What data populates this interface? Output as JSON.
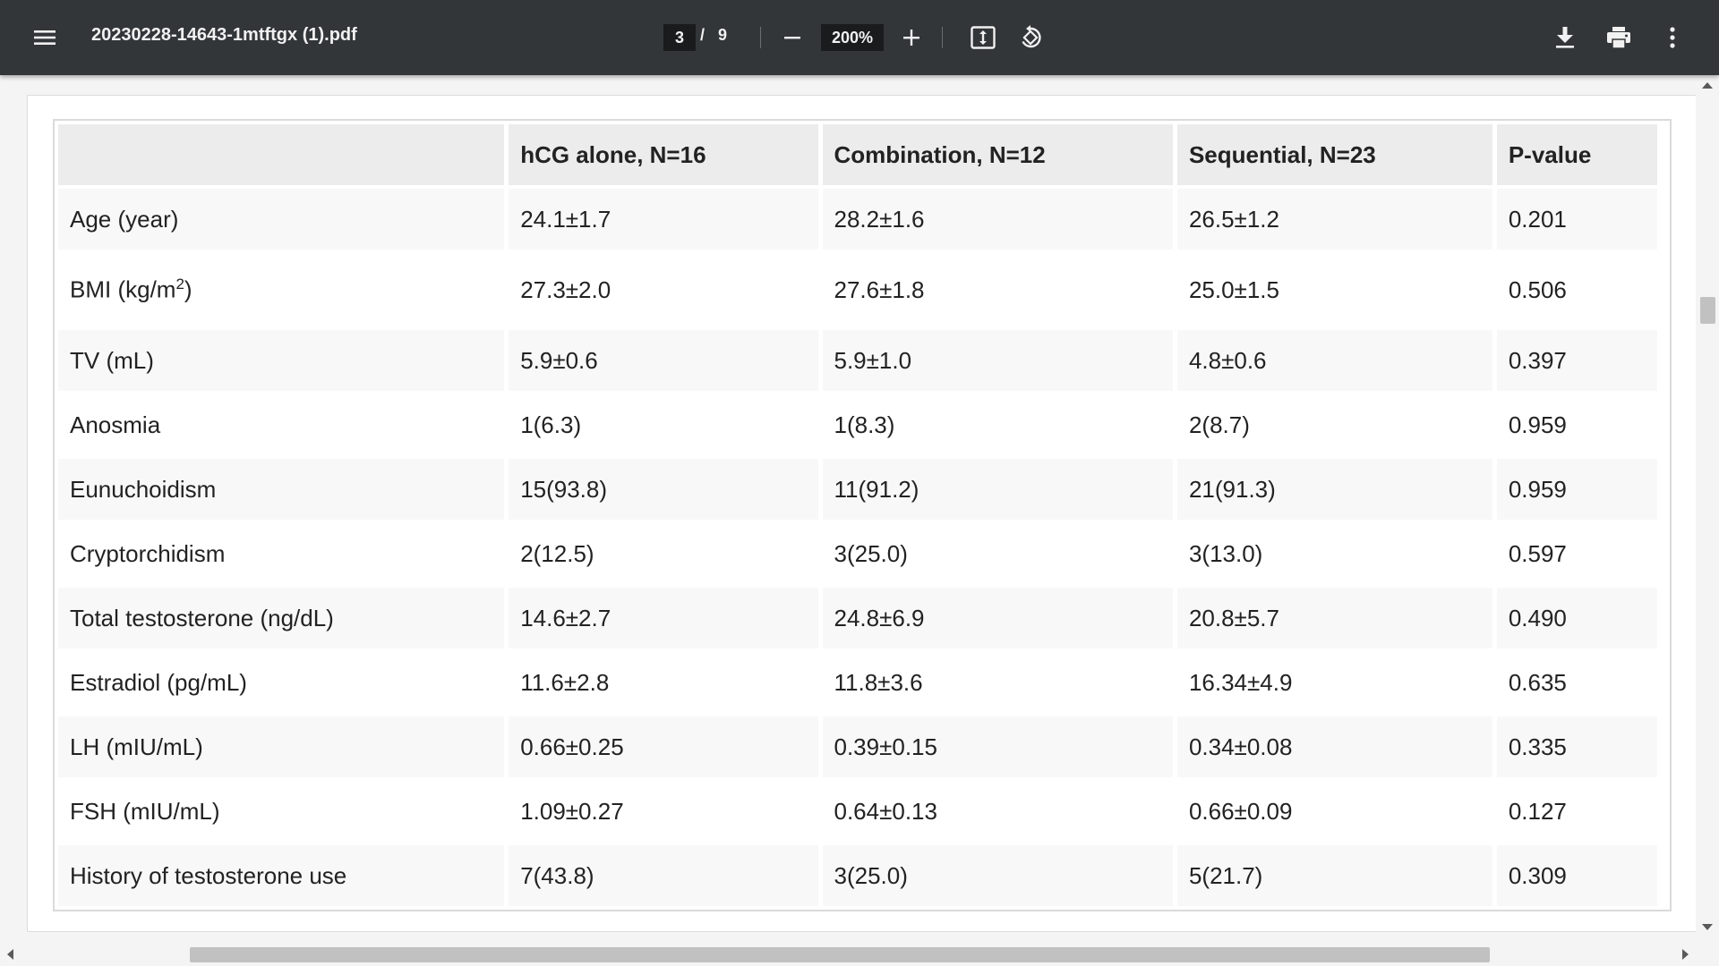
{
  "toolbar": {
    "title": "20230228-14643-1mtftgx (1).pdf",
    "current_page": "3",
    "page_separator": "/",
    "total_pages": "9",
    "zoom": "200%",
    "icons": {
      "menu": "hamburger-menu-icon",
      "zoom_out": "minus-icon",
      "zoom_in": "plus-icon",
      "fit": "fit-to-page-icon",
      "rotate": "rotate-counterclockwise-icon",
      "download": "download-icon",
      "print": "print-icon",
      "more": "more-vertical-icon"
    },
    "colors": {
      "toolbar_bg": "#323639",
      "toolbar_text": "#f1f1f1",
      "input_bg": "#191b1c"
    }
  },
  "table": {
    "headers": [
      "",
      "hCG alone, N=16",
      "Combination, N=12",
      "Sequential, N=23",
      "P-value"
    ],
    "rows": [
      {
        "label": "Age (year)",
        "values": [
          "24.1±1.7",
          "28.2±1.6",
          "26.5±1.2",
          "0.201"
        ]
      },
      {
        "label": "BMI (kg/m",
        "label_sup": "2",
        "label_after": ")",
        "values": [
          "27.3±2.0",
          "27.6±1.8",
          "25.0±1.5",
          "0.506"
        ]
      },
      {
        "label": "TV (mL)",
        "values": [
          "5.9±0.6",
          "5.9±1.0",
          "4.8±0.6",
          "0.397"
        ]
      },
      {
        "label": "Anosmia",
        "values": [
          "1(6.3)",
          "1(8.3)",
          "2(8.7)",
          "0.959"
        ]
      },
      {
        "label": "Eunuchoidism",
        "values": [
          "15(93.8)",
          "11(91.2)",
          "21(91.3)",
          "0.959"
        ]
      },
      {
        "label": "Cryptorchidism",
        "values": [
          "2(12.5)",
          "3(25.0)",
          "3(13.0)",
          "0.597"
        ]
      },
      {
        "label": "Total testosterone (ng/dL)",
        "values": [
          "14.6±2.7",
          "24.8±6.9",
          "20.8±5.7",
          "0.490"
        ]
      },
      {
        "label": "Estradiol (pg/mL)",
        "values": [
          "11.6±2.8",
          "11.8±3.6",
          "16.34±4.9",
          "0.635"
        ]
      },
      {
        "label": "LH (mIU/mL)",
        "values": [
          "0.66±0.25",
          "0.39±0.15",
          "0.34±0.08",
          "0.335"
        ]
      },
      {
        "label": "FSH (mIU/mL)",
        "values": [
          "1.09±0.27",
          "0.64±0.13",
          "0.66±0.09",
          "0.127"
        ]
      },
      {
        "label": "History of testosterone use",
        "values": [
          "7(43.8)",
          "3(25.0)",
          "5(21.7)",
          "0.309"
        ]
      }
    ]
  }
}
